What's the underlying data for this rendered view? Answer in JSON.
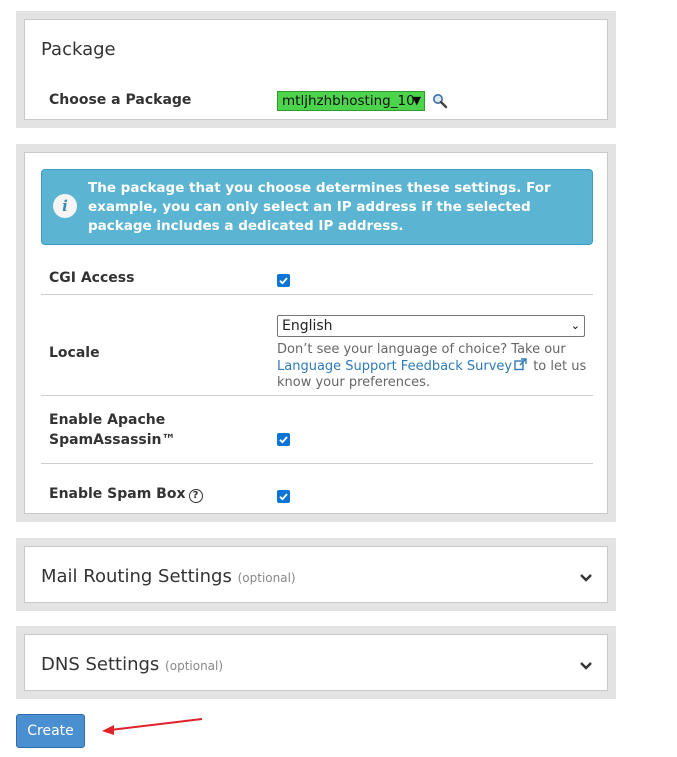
{
  "package_section": {
    "title": "Package",
    "choose_label": "Choose a Package",
    "selected_package": "mtljhzhbhosting_10",
    "search_icon": "magnifier-icon"
  },
  "settings_section": {
    "info_text": "The package that you choose determines these settings. For example, you can only select an IP address if the selected package includes a dedicated IP address.",
    "info_icon": "info-icon",
    "cgi_label": "CGI Access",
    "cgi_checked": true,
    "locale_label": "Locale",
    "locale_value": "English",
    "locale_help_before": "Don’t see your language of choice? Take our ",
    "locale_help_link": "Language Support Feedback Survey",
    "locale_help_after": " to let us know your preferences.",
    "spamassassin_label_line1": "Enable Apache",
    "spamassassin_label_line2": "SpamAssassin™",
    "spamassassin_checked": true,
    "spambox_label": "Enable Spam Box",
    "spambox_help_glyph": "?",
    "spambox_checked": true
  },
  "mail_routing": {
    "title": "Mail Routing Settings",
    "optional": "(optional)"
  },
  "dns": {
    "title": "DNS Settings",
    "optional": "(optional)"
  },
  "create_button": "Create",
  "colors": {
    "package_select_bg": "#4cd44c",
    "info_bg": "#5ab4d2",
    "checkbox": "#0b74d6",
    "primary_button": "#4a8fd0",
    "annotation_arrow": "#e0202a"
  }
}
